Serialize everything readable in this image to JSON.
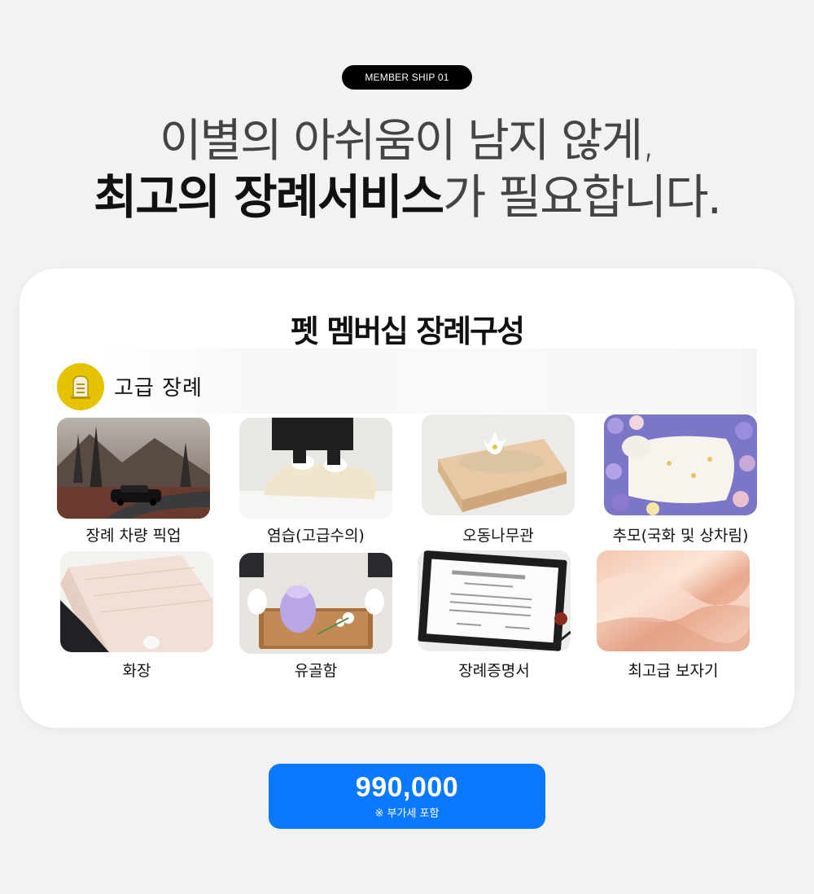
{
  "badge": "MEMBER SHIP 01",
  "headline": {
    "line1": "이별의 아쉬움이 남지 않게,",
    "line2_bold": "최고의 장례서비스",
    "line2_light": "가 필요합니다."
  },
  "card": {
    "title": "펫 멤버십 장례구성",
    "section": {
      "label": "고급 장례",
      "icon": "tombstone-icon",
      "icon_color": "#e6c300"
    },
    "items": [
      {
        "label": "장례 차량 픽업",
        "image": "hearse-car-photo"
      },
      {
        "label": "염습(고급수의)",
        "image": "shroud-wrapping-photo"
      },
      {
        "label": "오동나무관",
        "image": "paulownia-coffin-photo"
      },
      {
        "label": "추모(국화 및 상차림)",
        "image": "flower-memorial-photo"
      },
      {
        "label": "화장",
        "image": "cremation-photo"
      },
      {
        "label": "유골함",
        "image": "urn-photo"
      },
      {
        "label": "장례증명서",
        "image": "certificate-photo"
      },
      {
        "label": "최고급 보자기",
        "image": "silk-cloth-photo"
      }
    ]
  },
  "price": {
    "amount": "990,000",
    "note": "※ 부가세 포함",
    "color": "#0a79ff"
  }
}
